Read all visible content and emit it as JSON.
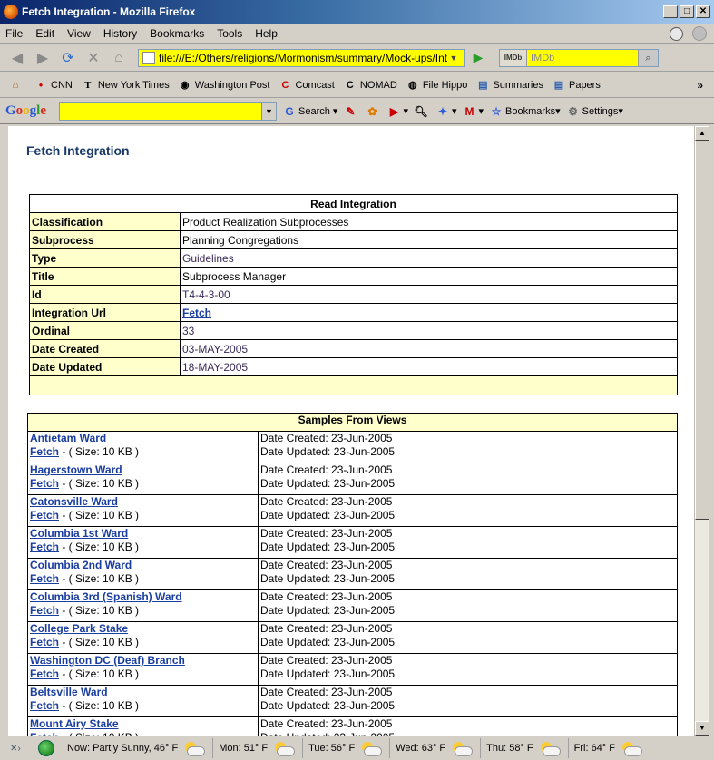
{
  "window": {
    "title": "Fetch Integration - Mozilla Firefox"
  },
  "menu": [
    "File",
    "Edit",
    "View",
    "History",
    "Bookmarks",
    "Tools",
    "Help"
  ],
  "nav": {
    "url": "file:///E:/Others/religions/Mormonism/summary/Mock-ups/Integrations",
    "search_engine": "IMDb",
    "search_placeholder": "IMDb"
  },
  "bookmarks": [
    "CNN",
    "New York Times",
    "Washington Post",
    "Comcast",
    "NOMAD",
    "File Hippo",
    "Summaries",
    "Papers"
  ],
  "google_toolbar": {
    "logo": "Google",
    "search": "Search",
    "bookmarks": "Bookmarks",
    "settings": "Settings"
  },
  "page": {
    "title": "Fetch Integration",
    "read": {
      "header": "Read Integration",
      "rows": [
        {
          "key": "Classification",
          "value": "Product Realization Subprocesses"
        },
        {
          "key": "Subprocess",
          "value": "Planning  Congregations"
        },
        {
          "key": "Type",
          "value": "Guidelines"
        },
        {
          "key": "Title",
          "value": "Subprocess Manager"
        },
        {
          "key": "Id",
          "value": "T4-4-3-00"
        },
        {
          "key": "Integration Url",
          "value": "Fetch"
        },
        {
          "key": "Ordinal",
          "value": "33"
        },
        {
          "key": "Date Created",
          "value": "03-MAY-2005"
        },
        {
          "key": "Date Updated",
          "value": "18-MAY-2005"
        }
      ]
    },
    "samples": {
      "header": "Samples From Views",
      "fetch_label": "Fetch",
      "size_text": " - ( Size: 10 KB )",
      "created_text": "Date Created: 23-Jun-2005",
      "updated_text": "Date Updated: 23-Jun-2005",
      "items": [
        "Antietam Ward",
        "Hagerstown Ward",
        "Catonsville Ward",
        "Columbia 1st Ward",
        "Columbia 2nd Ward",
        "Columbia 3rd (Spanish) Ward",
        "College Park Stake",
        "Washington DC (Deaf) Branch",
        "Beltsville Ward",
        "Mount Airy Stake"
      ]
    }
  },
  "status": {
    "now": "Now: Partly Sunny, 46° F",
    "forecast": [
      "Mon: 51° F",
      "Tue: 56° F",
      "Wed: 63° F",
      "Thu: 58° F",
      "Fri: 64° F"
    ]
  }
}
